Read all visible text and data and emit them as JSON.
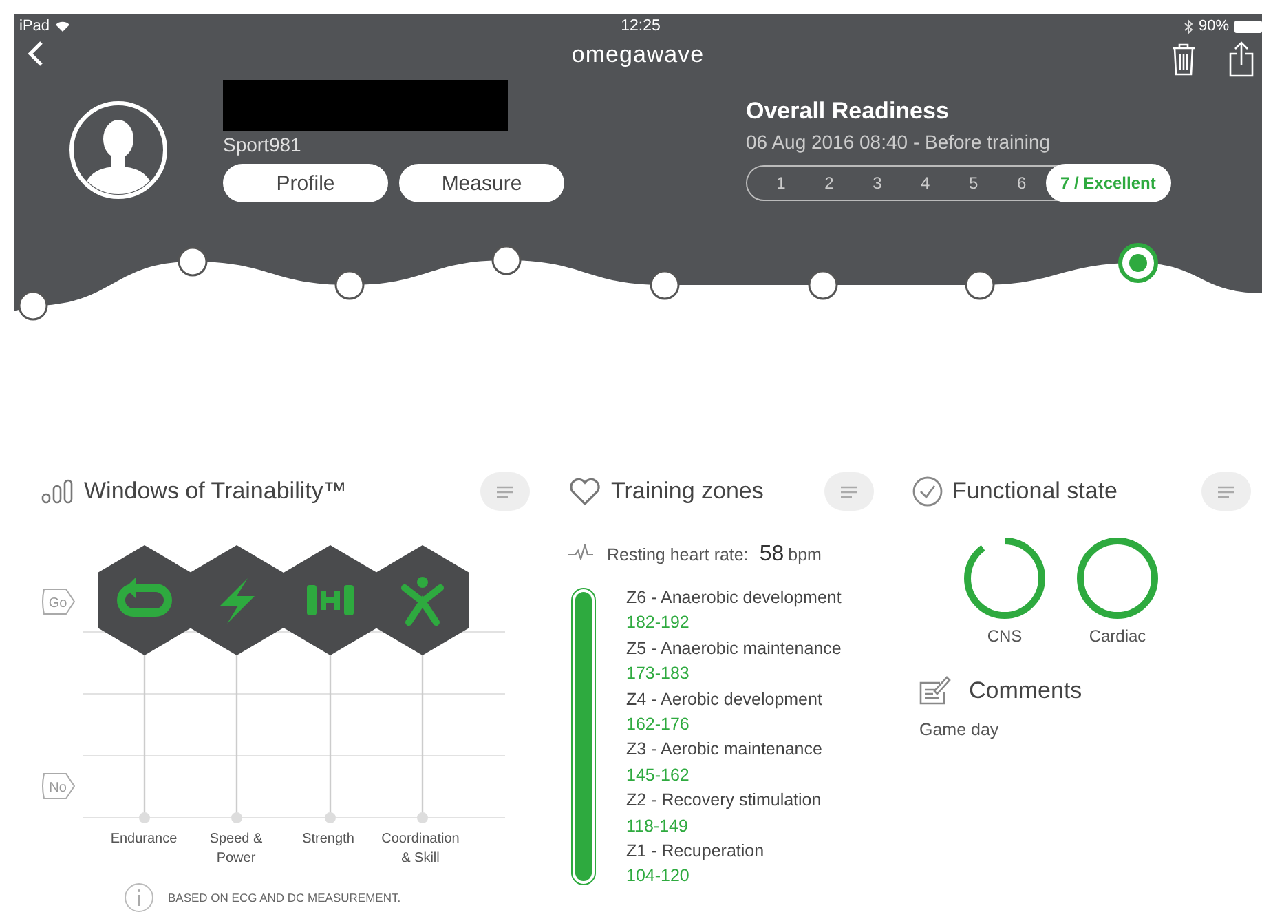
{
  "status_bar": {
    "device": "iPad",
    "time": "12:25",
    "battery": "90%"
  },
  "nav": {
    "logo": "omegawave"
  },
  "athlete": {
    "username": "Sport981",
    "buttons": [
      "Profile",
      "Measure"
    ]
  },
  "readiness": {
    "title": "Overall Readiness",
    "subtitle": "06 Aug 2016 08:40 - Before training",
    "scale": [
      {
        "label": "1",
        "selected": false
      },
      {
        "label": "2",
        "selected": false
      },
      {
        "label": "3",
        "selected": false
      },
      {
        "label": "4",
        "selected": false
      },
      {
        "label": "5",
        "selected": false
      },
      {
        "label": "6",
        "selected": false
      },
      {
        "label": "7 / Excellent",
        "selected": true
      }
    ]
  },
  "history": [
    {
      "selected": false
    },
    {
      "selected": false
    },
    {
      "selected": false
    },
    {
      "selected": false
    },
    {
      "selected": false
    },
    {
      "selected": false
    },
    {
      "selected": false
    },
    {
      "selected": true
    }
  ],
  "trainability": {
    "title": "Windows of Trainability™",
    "levels": [
      "Go",
      "No"
    ],
    "windows": [
      {
        "kind": "endurance",
        "label": "Endurance",
        "go": true
      },
      {
        "kind": "speed",
        "label": "Speed &\nPower",
        "go": true
      },
      {
        "kind": "strength",
        "label": "Strength",
        "go": true
      },
      {
        "kind": "coordination",
        "label": "Coordination\n& Skill",
        "go": true
      }
    ],
    "note": "BASED ON ECG AND DC MEASUREMENT."
  },
  "training_zones": {
    "title": "Training zones",
    "resting_label": "Resting heart rate:",
    "resting_value": "58",
    "resting_unit": "bpm",
    "zones": [
      {
        "name": "Z6 - Anaerobic development",
        "range": "182-192"
      },
      {
        "name": "Z5 - Anaerobic maintenance",
        "range": "173-183"
      },
      {
        "name": "Z4 - Aerobic development",
        "range": "162-176"
      },
      {
        "name": "Z3 - Aerobic maintenance",
        "range": "145-162"
      },
      {
        "name": "Z2 - Recovery stimulation",
        "range": "118-149"
      },
      {
        "name": "Z1 - Recuperation",
        "range": "104-120"
      }
    ]
  },
  "functional_state": {
    "title": "Functional state",
    "rings": [
      {
        "label": "CNS",
        "level": 0.9
      },
      {
        "label": "Cardiac",
        "level": 1
      }
    ]
  },
  "comments": {
    "title": "Comments",
    "text": "Game day"
  }
}
